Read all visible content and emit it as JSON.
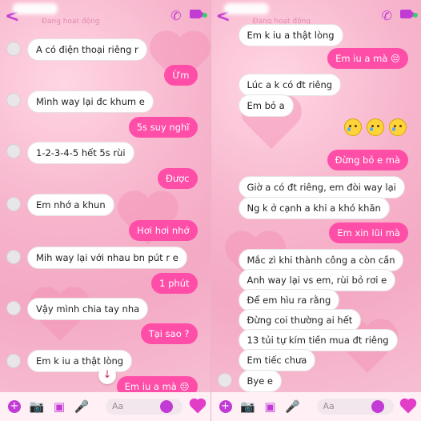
{
  "status_text": "Đang hoạt động",
  "composer_placeholder": "Aa",
  "left_messages": [
    {
      "side": "in",
      "text": "A có điện thoại riêng r"
    },
    {
      "side": "out",
      "text": "Ừm"
    },
    {
      "side": "in",
      "text": "Mình way lại đc khum e"
    },
    {
      "side": "out",
      "text": "5s suy nghĩ"
    },
    {
      "side": "in",
      "text": "1-2-3-4-5 hết 5s rùi"
    },
    {
      "side": "out",
      "text": "Được"
    },
    {
      "side": "in",
      "text": "Em nhớ a khun"
    },
    {
      "side": "out",
      "text": "Hơi hơi nhớ"
    },
    {
      "side": "in",
      "text": "Mih way lại với nhau bn pút r e"
    },
    {
      "side": "out",
      "text": "1 phút"
    },
    {
      "side": "in",
      "text": "Vậy mình chia tay nha"
    },
    {
      "side": "out",
      "text": "Tại sao ?"
    },
    {
      "side": "in",
      "text": "Em k iu a thật lòng"
    },
    {
      "side": "out",
      "text": "Em iu a mà 😔"
    }
  ],
  "right_messages": [
    {
      "side": "in",
      "text": "Em k iu a thật lòng"
    },
    {
      "side": "out",
      "text": "Em iu a mà 😔"
    },
    {
      "side": "in",
      "text": "Lúc a k có đt riêng"
    },
    {
      "side": "in",
      "text": "Em bỏ a"
    },
    {
      "side": "out",
      "text": "Đừng bỏ e mà"
    },
    {
      "side": "in",
      "text": "Giờ a có đt riêng, em đòi way lại"
    },
    {
      "side": "in",
      "text": "Ng k ở cạnh a khi a khó khăn"
    },
    {
      "side": "out",
      "text": "Em xin lũi mà"
    },
    {
      "side": "in",
      "text": "Mắc zì khi thành công a còn cần"
    },
    {
      "side": "in",
      "text": "Anh way lại vs em, rùi bỏ rơi e"
    },
    {
      "side": "in",
      "text": "Để em hìu ra rằng"
    },
    {
      "side": "in",
      "text": "Đừng coi thường ai hết"
    },
    {
      "side": "in",
      "text": "13 tủi tự kím tiền mua đt riêng"
    },
    {
      "side": "in",
      "text": "Em tiếc chưa"
    },
    {
      "side": "in",
      "text": "Bye e"
    }
  ],
  "colors": {
    "accent": "#c23bd4",
    "bubble_out": "#ff4ea8",
    "bubble_in": "#ffffff",
    "online": "#33d06a"
  }
}
